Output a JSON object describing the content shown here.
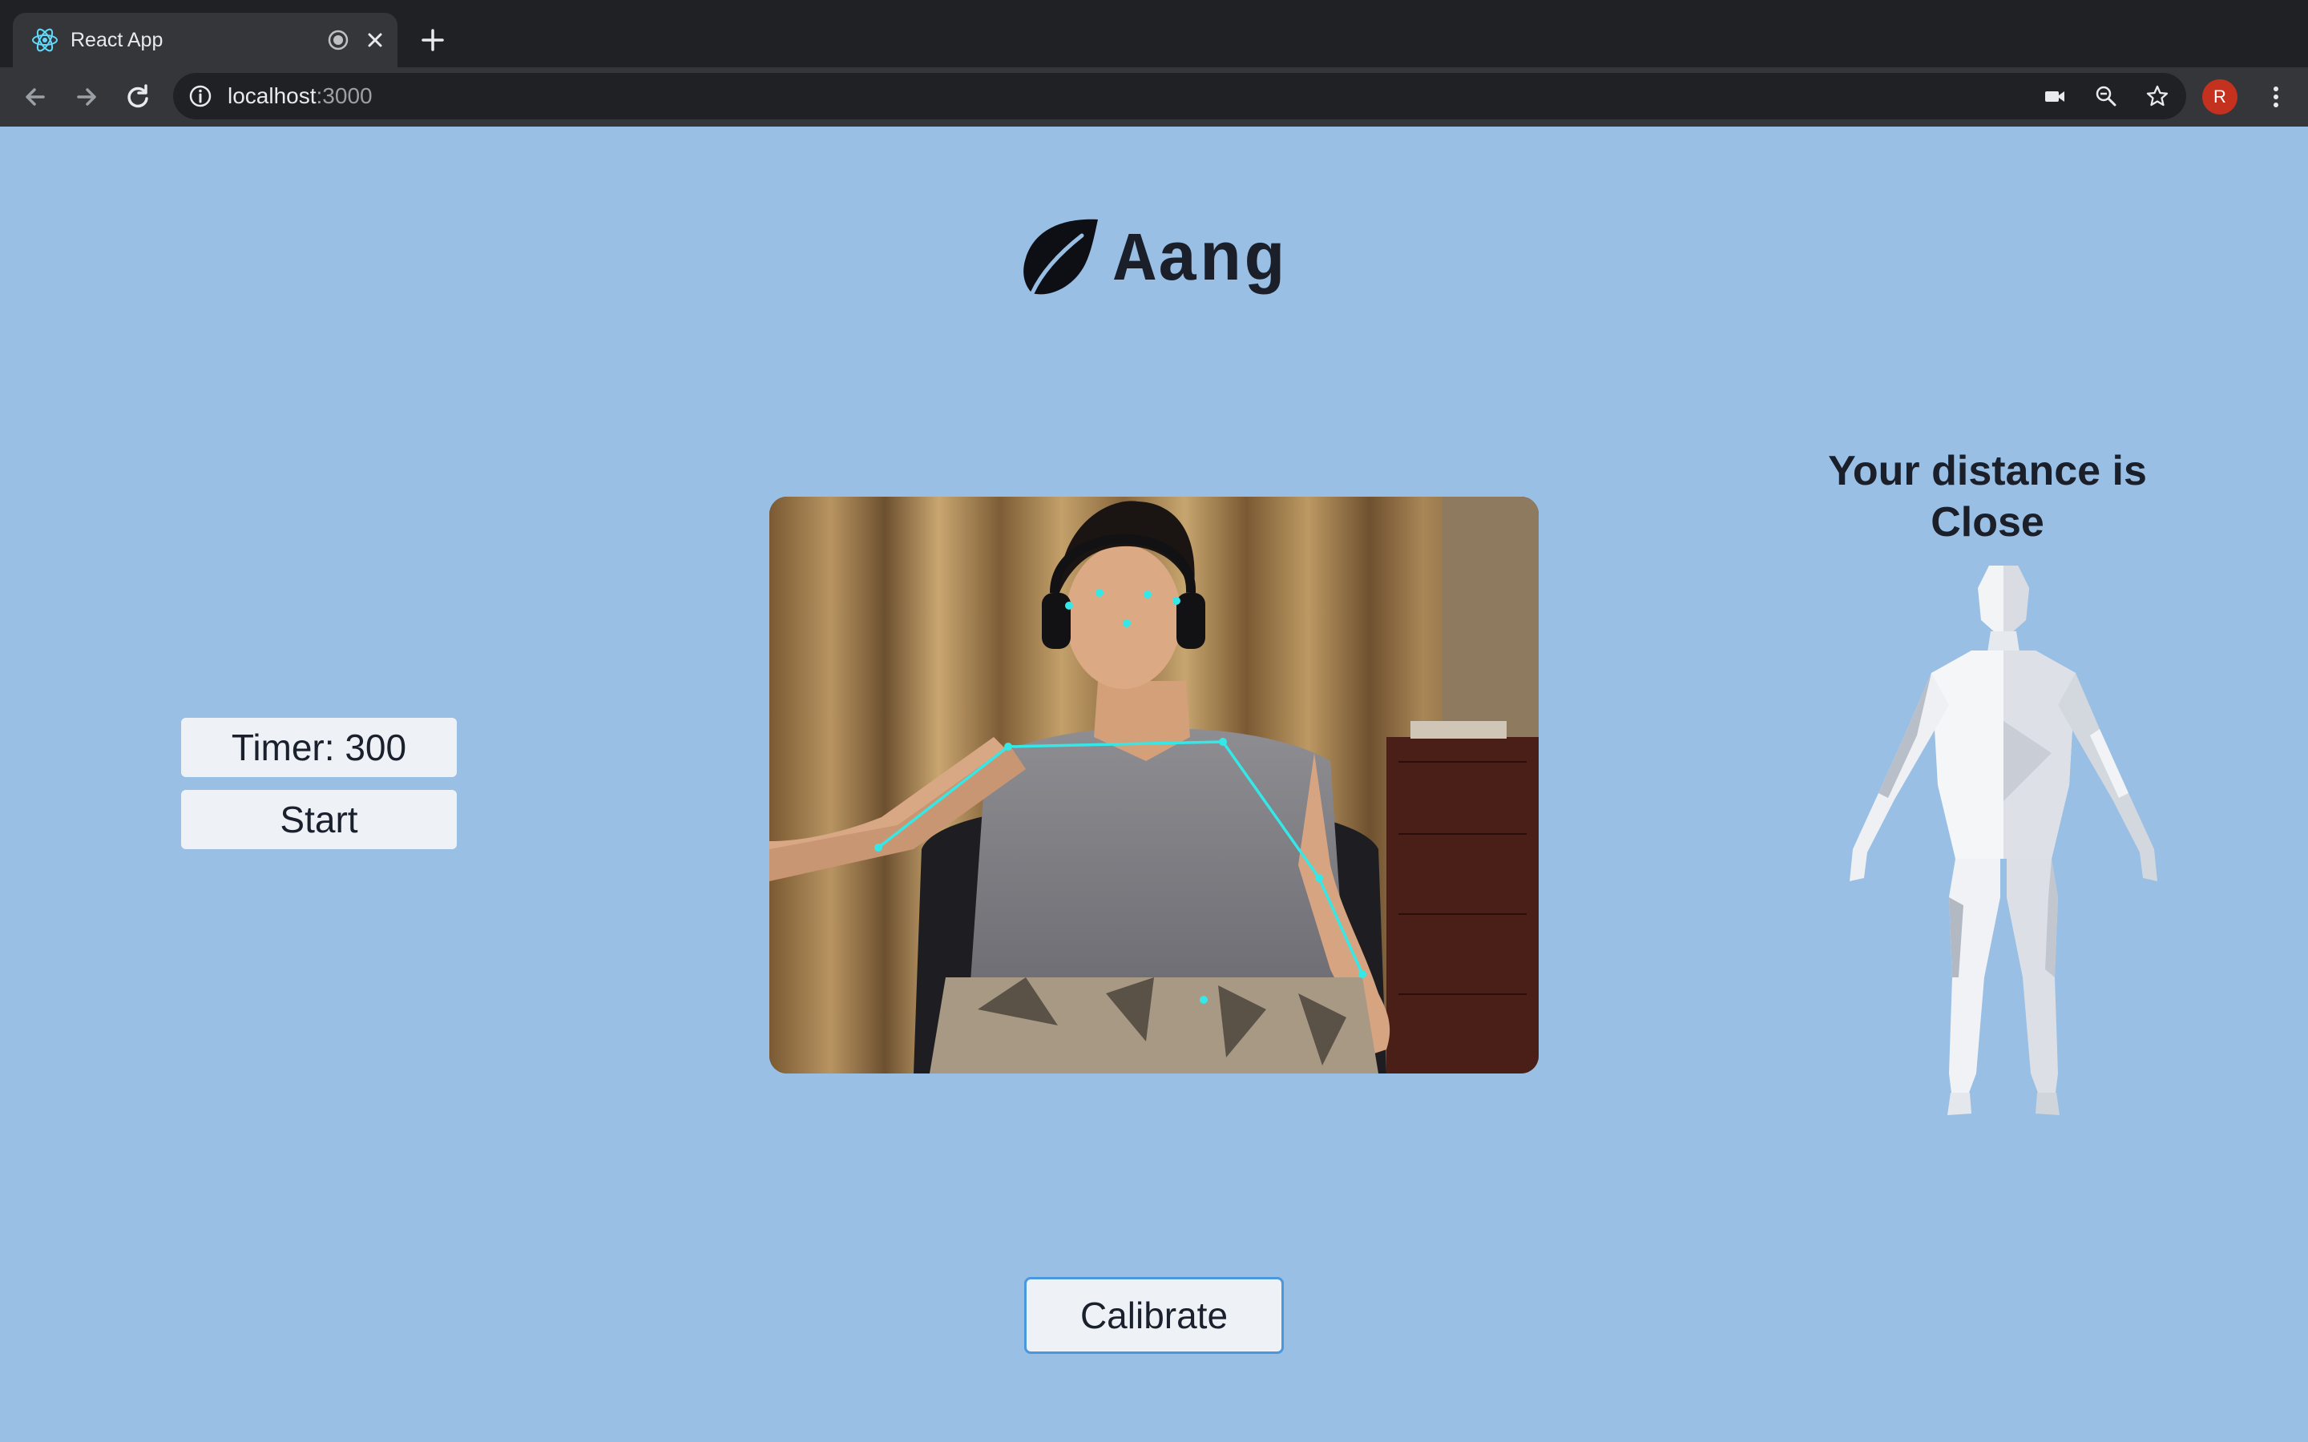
{
  "browser": {
    "tab_title": "React App",
    "url_host": "localhost",
    "url_port": ":3000",
    "profile_initial": "R",
    "icons": [
      "react-logo-icon",
      "audio-recording-icon",
      "close-icon",
      "new-tab-icon",
      "back-icon",
      "forward-icon",
      "reload-icon",
      "info-icon",
      "camera-icon",
      "zoom-icon",
      "star-icon",
      "menu-icon"
    ]
  },
  "app": {
    "logo_text": "Aang",
    "logo_icon": "leaf-icon",
    "background_color": "#99bfe4"
  },
  "controls": {
    "timer_label": "Timer: 300",
    "start_label": "Start",
    "calibrate_label": "Calibrate"
  },
  "status": {
    "distance_line1": "Your distance is",
    "distance_line2": "Close"
  },
  "pose_overlay": {
    "color": "#35e8e8"
  }
}
